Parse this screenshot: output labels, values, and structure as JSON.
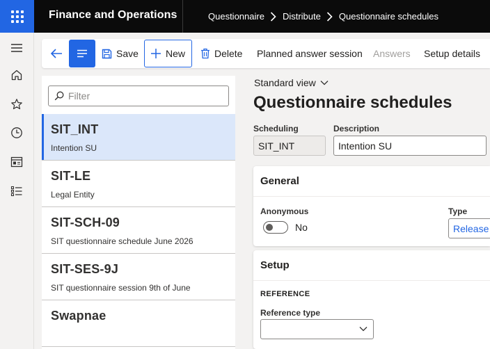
{
  "app": {
    "title": "Finance and Operations"
  },
  "breadcrumb": [
    "Questionnaire",
    "Distribute",
    "Questionnaire schedules"
  ],
  "actions": {
    "save": "Save",
    "new": "New",
    "delete": "Delete",
    "planned": "Planned answer session",
    "answers": "Answers",
    "setup": "Setup details"
  },
  "filter": {
    "placeholder": "Filter"
  },
  "list": [
    {
      "title": "SIT_INT",
      "subtitle": "Intention SU"
    },
    {
      "title": "SIT-LE",
      "subtitle": "Legal Entity"
    },
    {
      "title": "SIT-SCH-09",
      "subtitle": "SIT questionnaire schedule June 2026"
    },
    {
      "title": "SIT-SES-9J",
      "subtitle": "SIT questionnaire session 9th of June"
    },
    {
      "title": "Swapnae",
      "subtitle": ""
    }
  ],
  "detail": {
    "view": "Standard view",
    "title": "Questionnaire schedules",
    "scheduling_label": "Scheduling",
    "scheduling_value": "SIT_INT",
    "description_label": "Description",
    "description_value": "Intention SU"
  },
  "general": {
    "header": "General",
    "anonymous_label": "Anonymous",
    "anonymous_value": "No",
    "type_label": "Type",
    "type_value": "Release"
  },
  "setup": {
    "header": "Setup",
    "reference_section": "REFERENCE",
    "reference_type_label": "Reference type",
    "reference_type_value": ""
  },
  "colors": {
    "accent": "#2266e3",
    "topbar": "#0b0b0b",
    "selected_row": "#dbe7fa"
  }
}
